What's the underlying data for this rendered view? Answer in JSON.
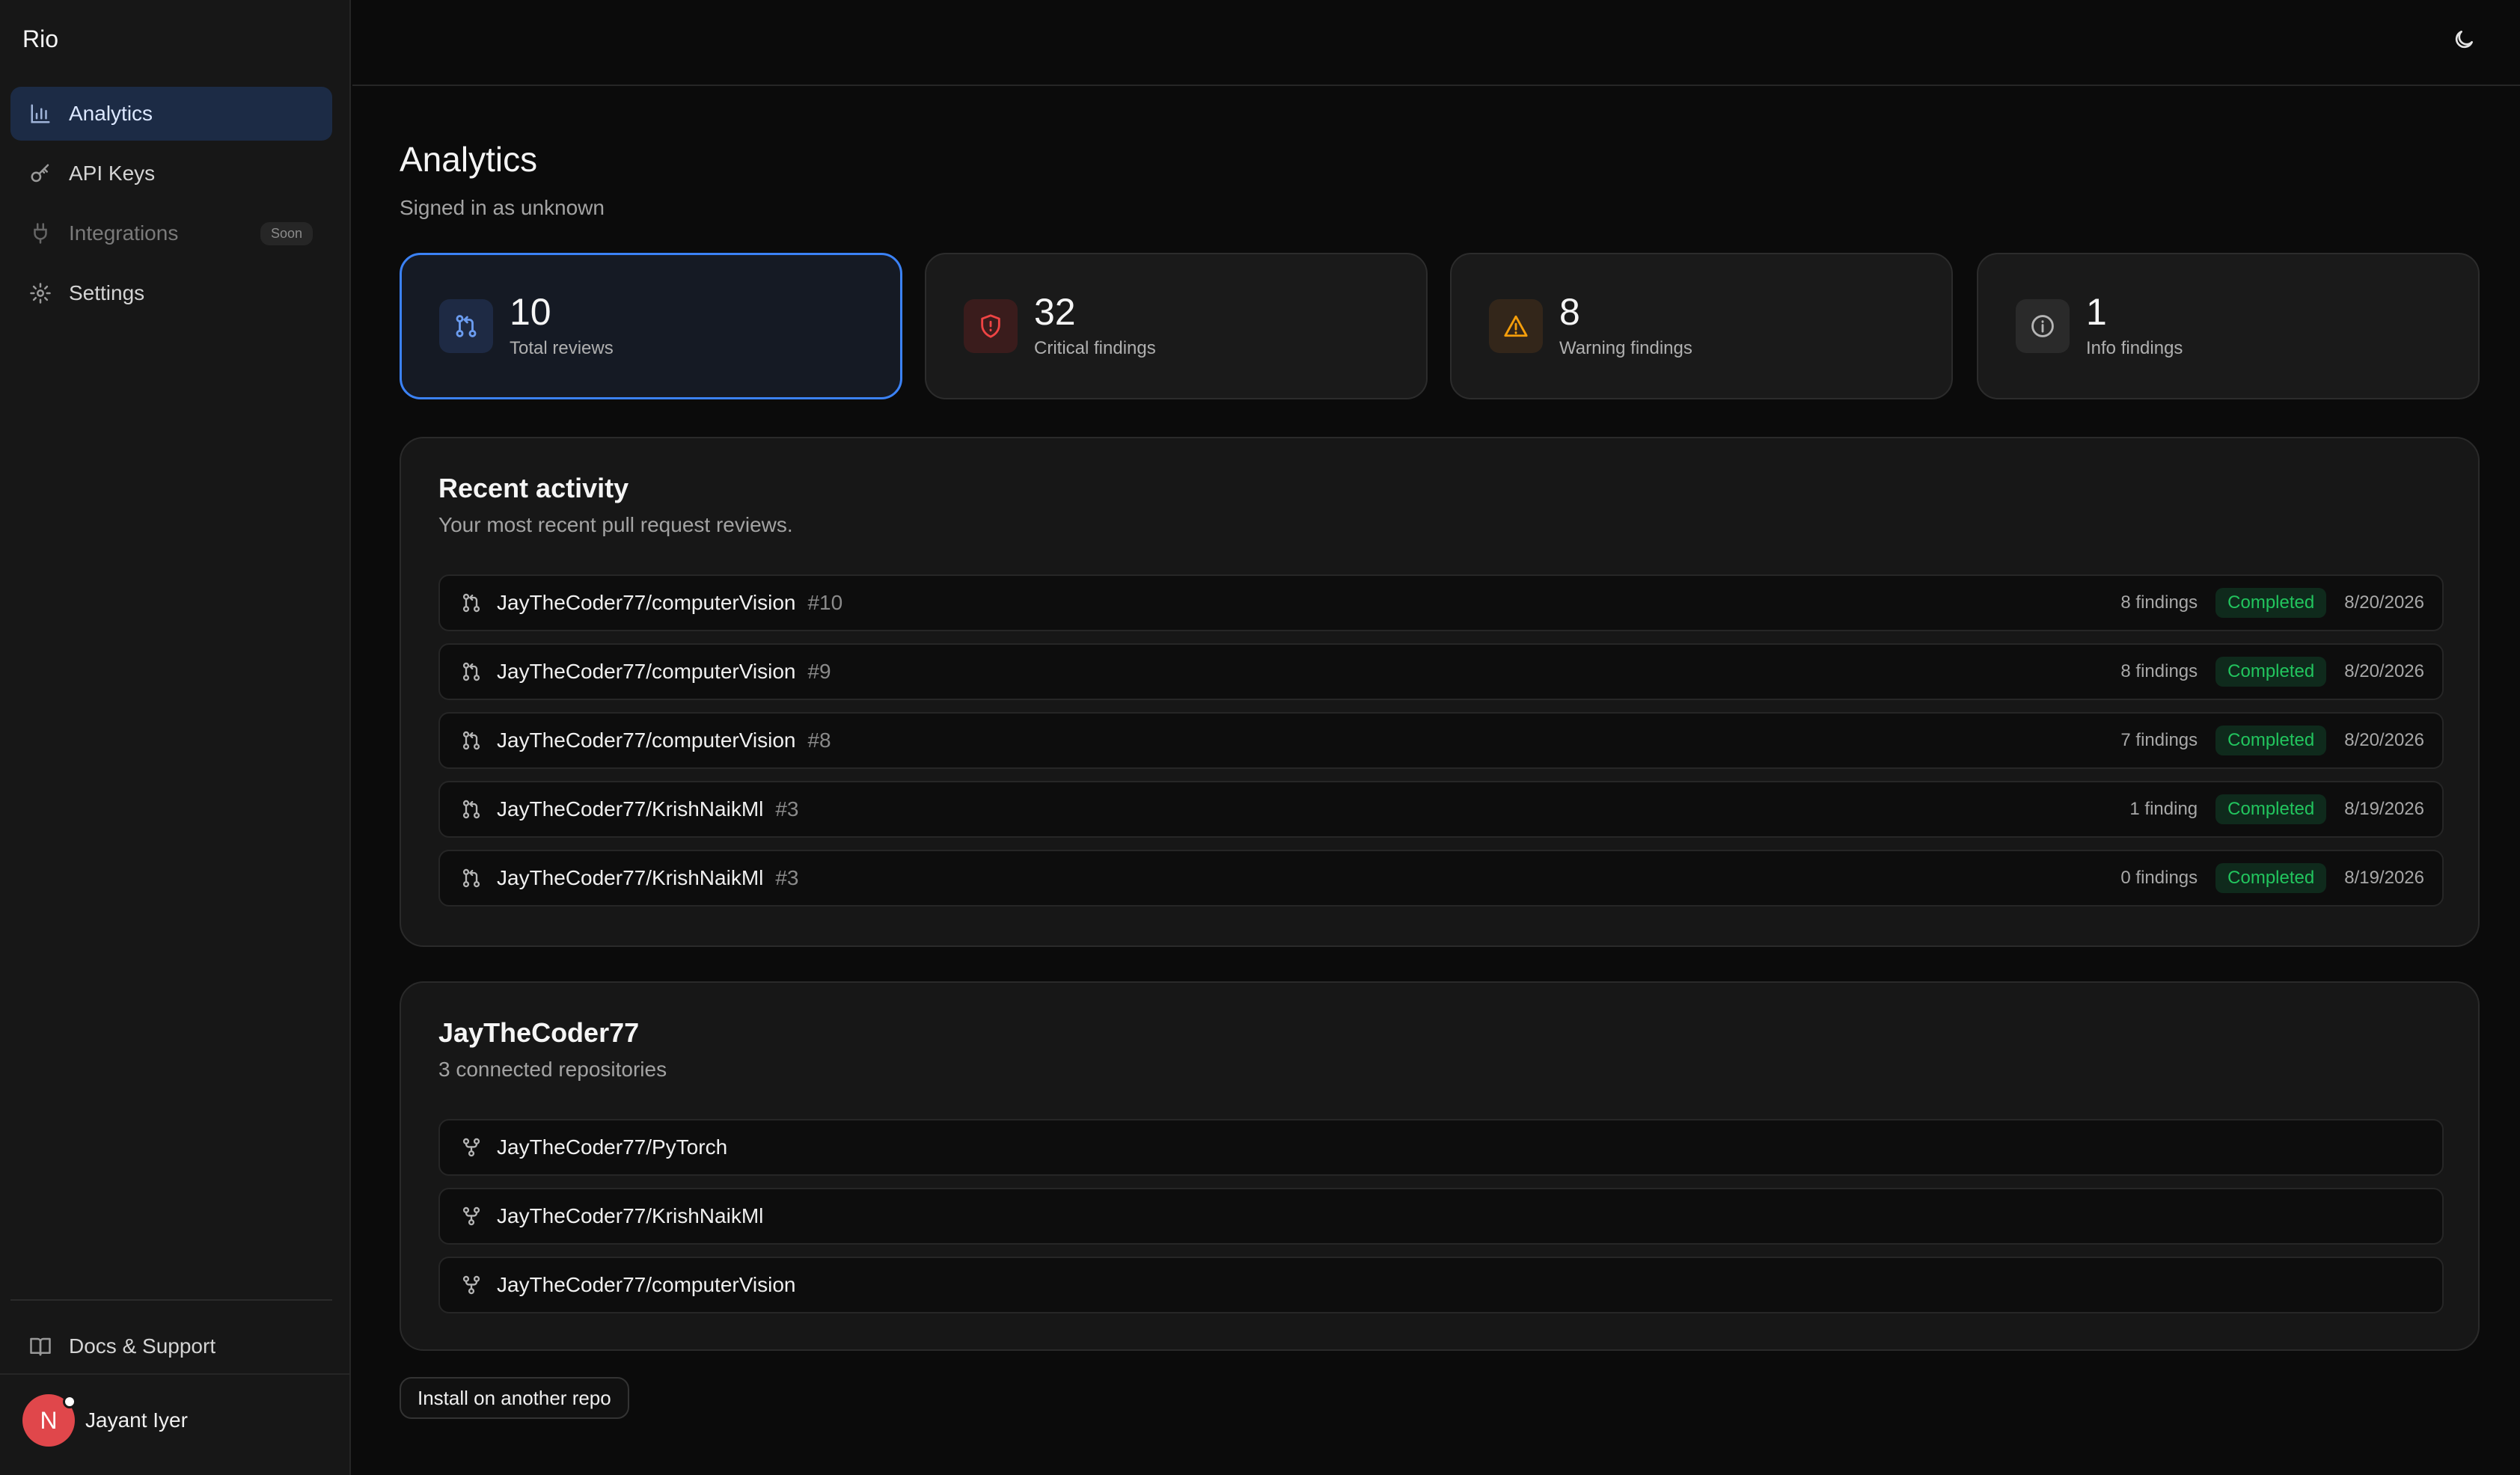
{
  "app": {
    "brand": "Rio"
  },
  "sidebar": {
    "items": [
      {
        "label": "Analytics",
        "icon": "bar-chart-icon",
        "active": true
      },
      {
        "label": "API Keys",
        "icon": "key-icon"
      },
      {
        "label": "Integrations",
        "icon": "plug-icon",
        "badge": "Soon",
        "disabled": true
      },
      {
        "label": "Settings",
        "icon": "gear-icon"
      }
    ],
    "docs_label": "Docs & Support",
    "user": {
      "name": "Jayant Iyer",
      "initial": "N"
    }
  },
  "header": {
    "theme_icon": "moon-icon"
  },
  "page": {
    "title": "Analytics",
    "subtitle": "Signed in as unknown"
  },
  "stats": [
    {
      "value": "10",
      "label": "Total reviews",
      "icon": "git-pull-request-icon",
      "color": "#3b82f6"
    },
    {
      "value": "32",
      "label": "Critical findings",
      "icon": "shield-icon",
      "color": "#ef4444"
    },
    {
      "value": "8",
      "label": "Warning findings",
      "icon": "warning-triangle-icon",
      "color": "#f59e0b"
    },
    {
      "value": "1",
      "label": "Info findings",
      "icon": "info-icon",
      "color": "#a3a3a3"
    }
  ],
  "recent": {
    "title": "Recent activity",
    "subtitle": "Your most recent pull request reviews.",
    "rows": [
      {
        "repo": "JayTheCoder77/computerVision",
        "pr": "#10",
        "findings": "8 findings",
        "status": "Completed",
        "date": "8/20/2026"
      },
      {
        "repo": "JayTheCoder77/computerVision",
        "pr": "#9",
        "findings": "8 findings",
        "status": "Completed",
        "date": "8/20/2026"
      },
      {
        "repo": "JayTheCoder77/computerVision",
        "pr": "#8",
        "findings": "7 findings",
        "status": "Completed",
        "date": "8/20/2026"
      },
      {
        "repo": "JayTheCoder77/KrishNaikMl",
        "pr": "#3",
        "findings": "1 finding",
        "status": "Completed",
        "date": "8/19/2026"
      },
      {
        "repo": "JayTheCoder77/KrishNaikMl",
        "pr": "#3",
        "findings": "0 findings",
        "status": "Completed",
        "date": "8/19/2026"
      }
    ]
  },
  "repos": {
    "title": "JayTheCoder77",
    "subtitle": "3 connected repositories",
    "items": [
      {
        "name": "JayTheCoder77/PyTorch"
      },
      {
        "name": "JayTheCoder77/KrishNaikMl"
      },
      {
        "name": "JayTheCoder77/computerVision"
      }
    ]
  },
  "install_button": "Install on another repo"
}
